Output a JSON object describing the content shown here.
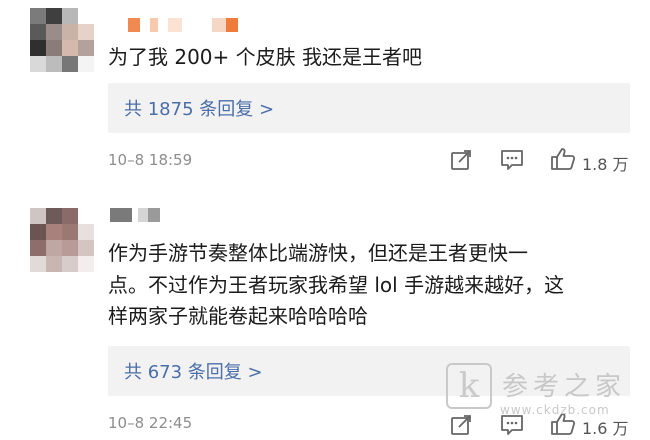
{
  "comments": [
    {
      "text": "为了我 200+ 个皮肤 我还是王者吧",
      "reply_label": "共 1875 条回复 >",
      "time": "10–8 18:59",
      "likes": "1.8 万"
    },
    {
      "text_lines": [
        "作为手游节奏整体比端游快，但还是王者更快一",
        "点。不过作为王者玩家我希望 lol 手游越来越好，这",
        "样两家子就能卷起来哈哈哈哈"
      ],
      "reply_label": "共 673 条回复 >",
      "time": "10–8 22:45",
      "likes": "1.6 万"
    }
  ],
  "watermark": {
    "logo_letter": "k",
    "text": "参考之家",
    "url": "www.ckdzb.com"
  },
  "icons": [
    "share-icon",
    "comment-icon",
    "like-icon"
  ],
  "colors": {
    "reply_link": "#4a6ea8",
    "meta_gray": "#8d8d8d",
    "reply_bg": "#f2f2f2"
  }
}
